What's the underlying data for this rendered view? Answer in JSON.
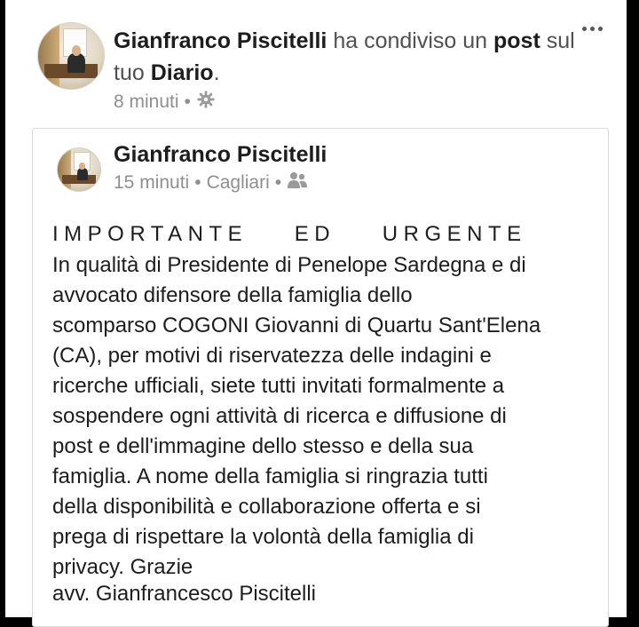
{
  "shared_header": {
    "author": "Gianfranco Piscitelli",
    "text_part1": "ha condiviso un",
    "post_word": "post",
    "text_part2": "sul tuo",
    "diary_word": "Diario",
    "period": ".",
    "time": "8 minuti",
    "separator": "•",
    "privacy_icon": "gear-icon",
    "menu_icon": "more-options-icon"
  },
  "original_post": {
    "author": "Gianfranco Piscitelli",
    "time": "15 minuti",
    "separator": "•",
    "location": "Cagliari",
    "audience_icon": "friends-icon",
    "title": "IMPORTANTE    ED    URGENTE",
    "body_lines": [
      "In qualità di Presidente di Penelope Sardegna e di",
      "avvocato difensore della famiglia dello",
      "scomparso COGONI Giovanni di Quartu Sant'Elena",
      "(CA), per motivi di riservatezza delle indagini e",
      "ricerche ufficiali,  siete tutti invitati formalmente a",
      "sospendere ogni attività di ricerca e diffusione di",
      "post e dell'immagine dello stesso e della sua",
      "famiglia. A nome della famiglia si ringrazia tutti",
      "della disponibilità e collaborazione offerta e si",
      "prega di rispettare la volontà della famiglia di",
      "privacy. Grazie"
    ],
    "signature": "avv. Gianfrancesco Piscitelli"
  }
}
